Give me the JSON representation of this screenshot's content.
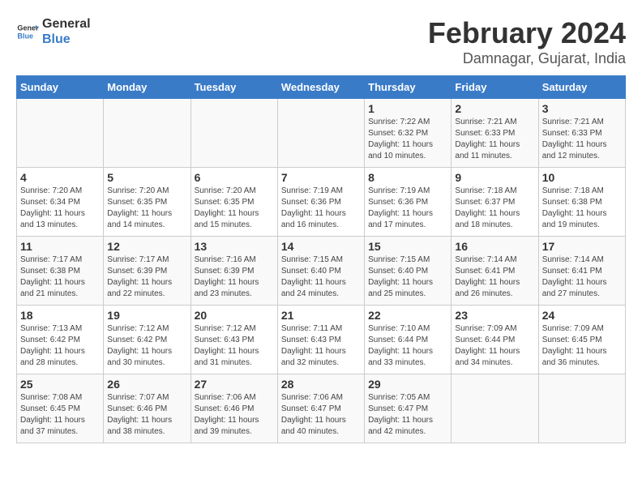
{
  "logo": {
    "line1": "General",
    "line2": "Blue"
  },
  "title": "February 2024",
  "subtitle": "Damnagar, Gujarat, India",
  "days_of_week": [
    "Sunday",
    "Monday",
    "Tuesday",
    "Wednesday",
    "Thursday",
    "Friday",
    "Saturday"
  ],
  "weeks": [
    [
      {
        "day": "",
        "info": ""
      },
      {
        "day": "",
        "info": ""
      },
      {
        "day": "",
        "info": ""
      },
      {
        "day": "",
        "info": ""
      },
      {
        "day": "1",
        "info": "Sunrise: 7:22 AM\nSunset: 6:32 PM\nDaylight: 11 hours\nand 10 minutes."
      },
      {
        "day": "2",
        "info": "Sunrise: 7:21 AM\nSunset: 6:33 PM\nDaylight: 11 hours\nand 11 minutes."
      },
      {
        "day": "3",
        "info": "Sunrise: 7:21 AM\nSunset: 6:33 PM\nDaylight: 11 hours\nand 12 minutes."
      }
    ],
    [
      {
        "day": "4",
        "info": "Sunrise: 7:20 AM\nSunset: 6:34 PM\nDaylight: 11 hours\nand 13 minutes."
      },
      {
        "day": "5",
        "info": "Sunrise: 7:20 AM\nSunset: 6:35 PM\nDaylight: 11 hours\nand 14 minutes."
      },
      {
        "day": "6",
        "info": "Sunrise: 7:20 AM\nSunset: 6:35 PM\nDaylight: 11 hours\nand 15 minutes."
      },
      {
        "day": "7",
        "info": "Sunrise: 7:19 AM\nSunset: 6:36 PM\nDaylight: 11 hours\nand 16 minutes."
      },
      {
        "day": "8",
        "info": "Sunrise: 7:19 AM\nSunset: 6:36 PM\nDaylight: 11 hours\nand 17 minutes."
      },
      {
        "day": "9",
        "info": "Sunrise: 7:18 AM\nSunset: 6:37 PM\nDaylight: 11 hours\nand 18 minutes."
      },
      {
        "day": "10",
        "info": "Sunrise: 7:18 AM\nSunset: 6:38 PM\nDaylight: 11 hours\nand 19 minutes."
      }
    ],
    [
      {
        "day": "11",
        "info": "Sunrise: 7:17 AM\nSunset: 6:38 PM\nDaylight: 11 hours\nand 21 minutes."
      },
      {
        "day": "12",
        "info": "Sunrise: 7:17 AM\nSunset: 6:39 PM\nDaylight: 11 hours\nand 22 minutes."
      },
      {
        "day": "13",
        "info": "Sunrise: 7:16 AM\nSunset: 6:39 PM\nDaylight: 11 hours\nand 23 minutes."
      },
      {
        "day": "14",
        "info": "Sunrise: 7:15 AM\nSunset: 6:40 PM\nDaylight: 11 hours\nand 24 minutes."
      },
      {
        "day": "15",
        "info": "Sunrise: 7:15 AM\nSunset: 6:40 PM\nDaylight: 11 hours\nand 25 minutes."
      },
      {
        "day": "16",
        "info": "Sunrise: 7:14 AM\nSunset: 6:41 PM\nDaylight: 11 hours\nand 26 minutes."
      },
      {
        "day": "17",
        "info": "Sunrise: 7:14 AM\nSunset: 6:41 PM\nDaylight: 11 hours\nand 27 minutes."
      }
    ],
    [
      {
        "day": "18",
        "info": "Sunrise: 7:13 AM\nSunset: 6:42 PM\nDaylight: 11 hours\nand 28 minutes."
      },
      {
        "day": "19",
        "info": "Sunrise: 7:12 AM\nSunset: 6:42 PM\nDaylight: 11 hours\nand 30 minutes."
      },
      {
        "day": "20",
        "info": "Sunrise: 7:12 AM\nSunset: 6:43 PM\nDaylight: 11 hours\nand 31 minutes."
      },
      {
        "day": "21",
        "info": "Sunrise: 7:11 AM\nSunset: 6:43 PM\nDaylight: 11 hours\nand 32 minutes."
      },
      {
        "day": "22",
        "info": "Sunrise: 7:10 AM\nSunset: 6:44 PM\nDaylight: 11 hours\nand 33 minutes."
      },
      {
        "day": "23",
        "info": "Sunrise: 7:09 AM\nSunset: 6:44 PM\nDaylight: 11 hours\nand 34 minutes."
      },
      {
        "day": "24",
        "info": "Sunrise: 7:09 AM\nSunset: 6:45 PM\nDaylight: 11 hours\nand 36 minutes."
      }
    ],
    [
      {
        "day": "25",
        "info": "Sunrise: 7:08 AM\nSunset: 6:45 PM\nDaylight: 11 hours\nand 37 minutes."
      },
      {
        "day": "26",
        "info": "Sunrise: 7:07 AM\nSunset: 6:46 PM\nDaylight: 11 hours\nand 38 minutes."
      },
      {
        "day": "27",
        "info": "Sunrise: 7:06 AM\nSunset: 6:46 PM\nDaylight: 11 hours\nand 39 minutes."
      },
      {
        "day": "28",
        "info": "Sunrise: 7:06 AM\nSunset: 6:47 PM\nDaylight: 11 hours\nand 40 minutes."
      },
      {
        "day": "29",
        "info": "Sunrise: 7:05 AM\nSunset: 6:47 PM\nDaylight: 11 hours\nand 42 minutes."
      },
      {
        "day": "",
        "info": ""
      },
      {
        "day": "",
        "info": ""
      }
    ]
  ]
}
